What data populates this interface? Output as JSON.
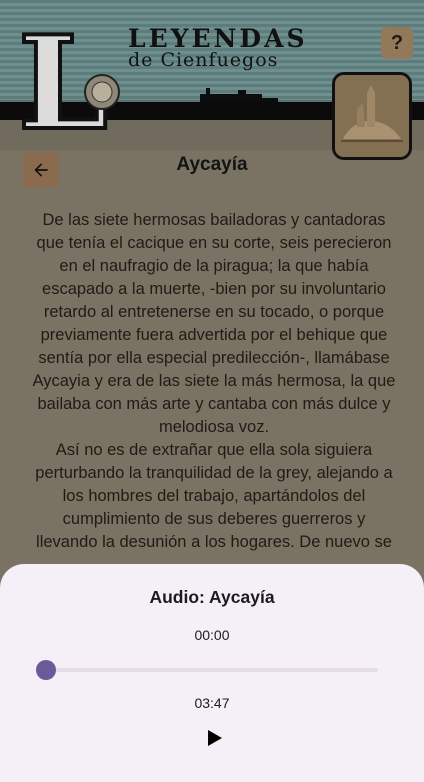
{
  "header": {
    "logo_letter": "L",
    "title_line1": "LEYENDAS",
    "title_line2": "de Cienfuegos",
    "help_label": "?"
  },
  "icons": {
    "back": "arrow-left-icon",
    "help": "help-icon",
    "play": "play-icon"
  },
  "story": {
    "title": "Aycayía",
    "paragraphs": [
      "De las siete hermosas bailadoras y cantadoras que tenía el cacique en su corte, seis perecieron en el naufragio de la piragua; la que había escapado a la muerte, -bien por su involuntario retardo al entretenerse en su tocado, o porque previamente fuera advertida por el behique que sentía por ella especial predilección-, llamábase Aycayia y era de las siete la más hermosa, la que bailaba con más arte y cantaba con más dulce y melodiosa voz.",
      "Así no es de extrañar que ella sola siguiera perturbando la tranquilidad de la grey, alejando a los hombres del trabajo, apartándolos del cumplimiento de sus deberes guerreros y llevando la desunión a los hogares. De nuevo se"
    ]
  },
  "player": {
    "title": "Audio: Aycayía",
    "current_time": "00:00",
    "total_time": "03:47",
    "progress": 0,
    "accent_color": "#6a5a9a"
  }
}
